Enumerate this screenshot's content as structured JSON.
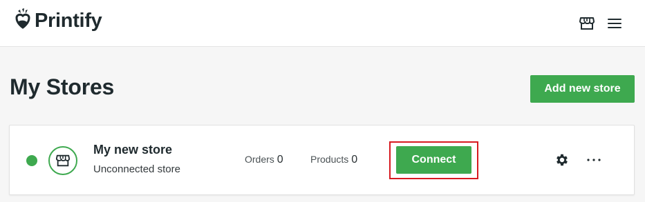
{
  "header": {
    "brand": "Printify",
    "icons": {
      "logo": "printify-logo-icon",
      "store": "storefront-icon",
      "menu": "hamburger-menu-icon"
    }
  },
  "page": {
    "title": "My Stores",
    "add_store_label": "Add new store"
  },
  "stores": [
    {
      "name": "My new store",
      "status_text": "Unconnected store",
      "status_color": "#3ea94f",
      "orders_label": "Orders",
      "orders_count": "0",
      "products_label": "Products",
      "products_count": "0",
      "connect_label": "Connect",
      "icons": {
        "avatar": "storefront-icon",
        "settings": "gear-icon",
        "more": "more-dots-icon"
      }
    }
  ],
  "colors": {
    "accent": "#3ea94f",
    "highlight": "#d7191f",
    "text": "#1f2a2e"
  }
}
